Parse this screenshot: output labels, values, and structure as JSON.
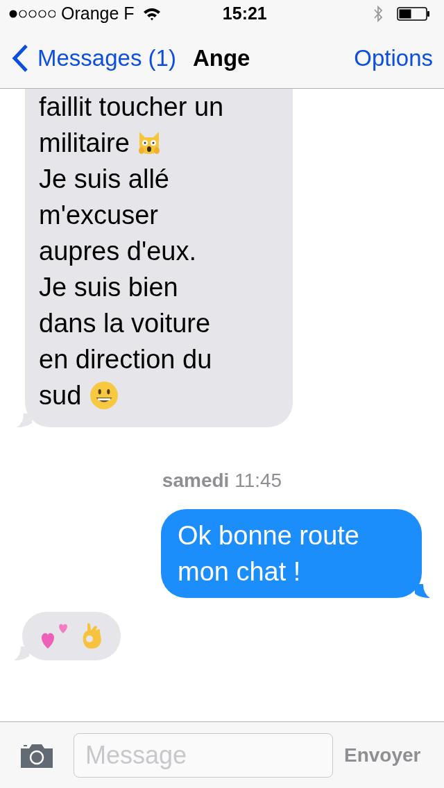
{
  "status_bar": {
    "carrier": "Orange F",
    "time": "15:21"
  },
  "nav_bar": {
    "back": "Messages (1)",
    "title": "Ange",
    "action": "Options"
  },
  "messages": [
    {
      "kind": "received",
      "lines": [
        {
          "text": "faillit toucher un"
        },
        {
          "text": "militaire",
          "icon": {
            "kind": "cat-scream"
          }
        },
        {
          "text": "Je suis allé"
        },
        {
          "text": "m'excuser"
        },
        {
          "text": "aupres d'eux."
        },
        {
          "text": "Je suis bien"
        },
        {
          "text": "dans la voiture"
        },
        {
          "text": "en direction du"
        },
        {
          "text": "sud",
          "icon": {
            "kind": "grin"
          }
        }
      ]
    },
    {
      "kind": "timestamp",
      "text": "**samedi** 11:45"
    },
    {
      "kind": "sent",
      "lines": [
        {
          "text": "Ok bonne route"
        },
        {
          "text": "mon chat !"
        }
      ]
    },
    {
      "kind": "emoji",
      "emojis": [
        {
          "kind": "hearts"
        },
        {
          "kind": "ok-hand"
        }
      ]
    }
  ],
  "composer": {
    "placeholder": "Message",
    "send": "Envoyer",
    "send_disabled": true
  }
}
